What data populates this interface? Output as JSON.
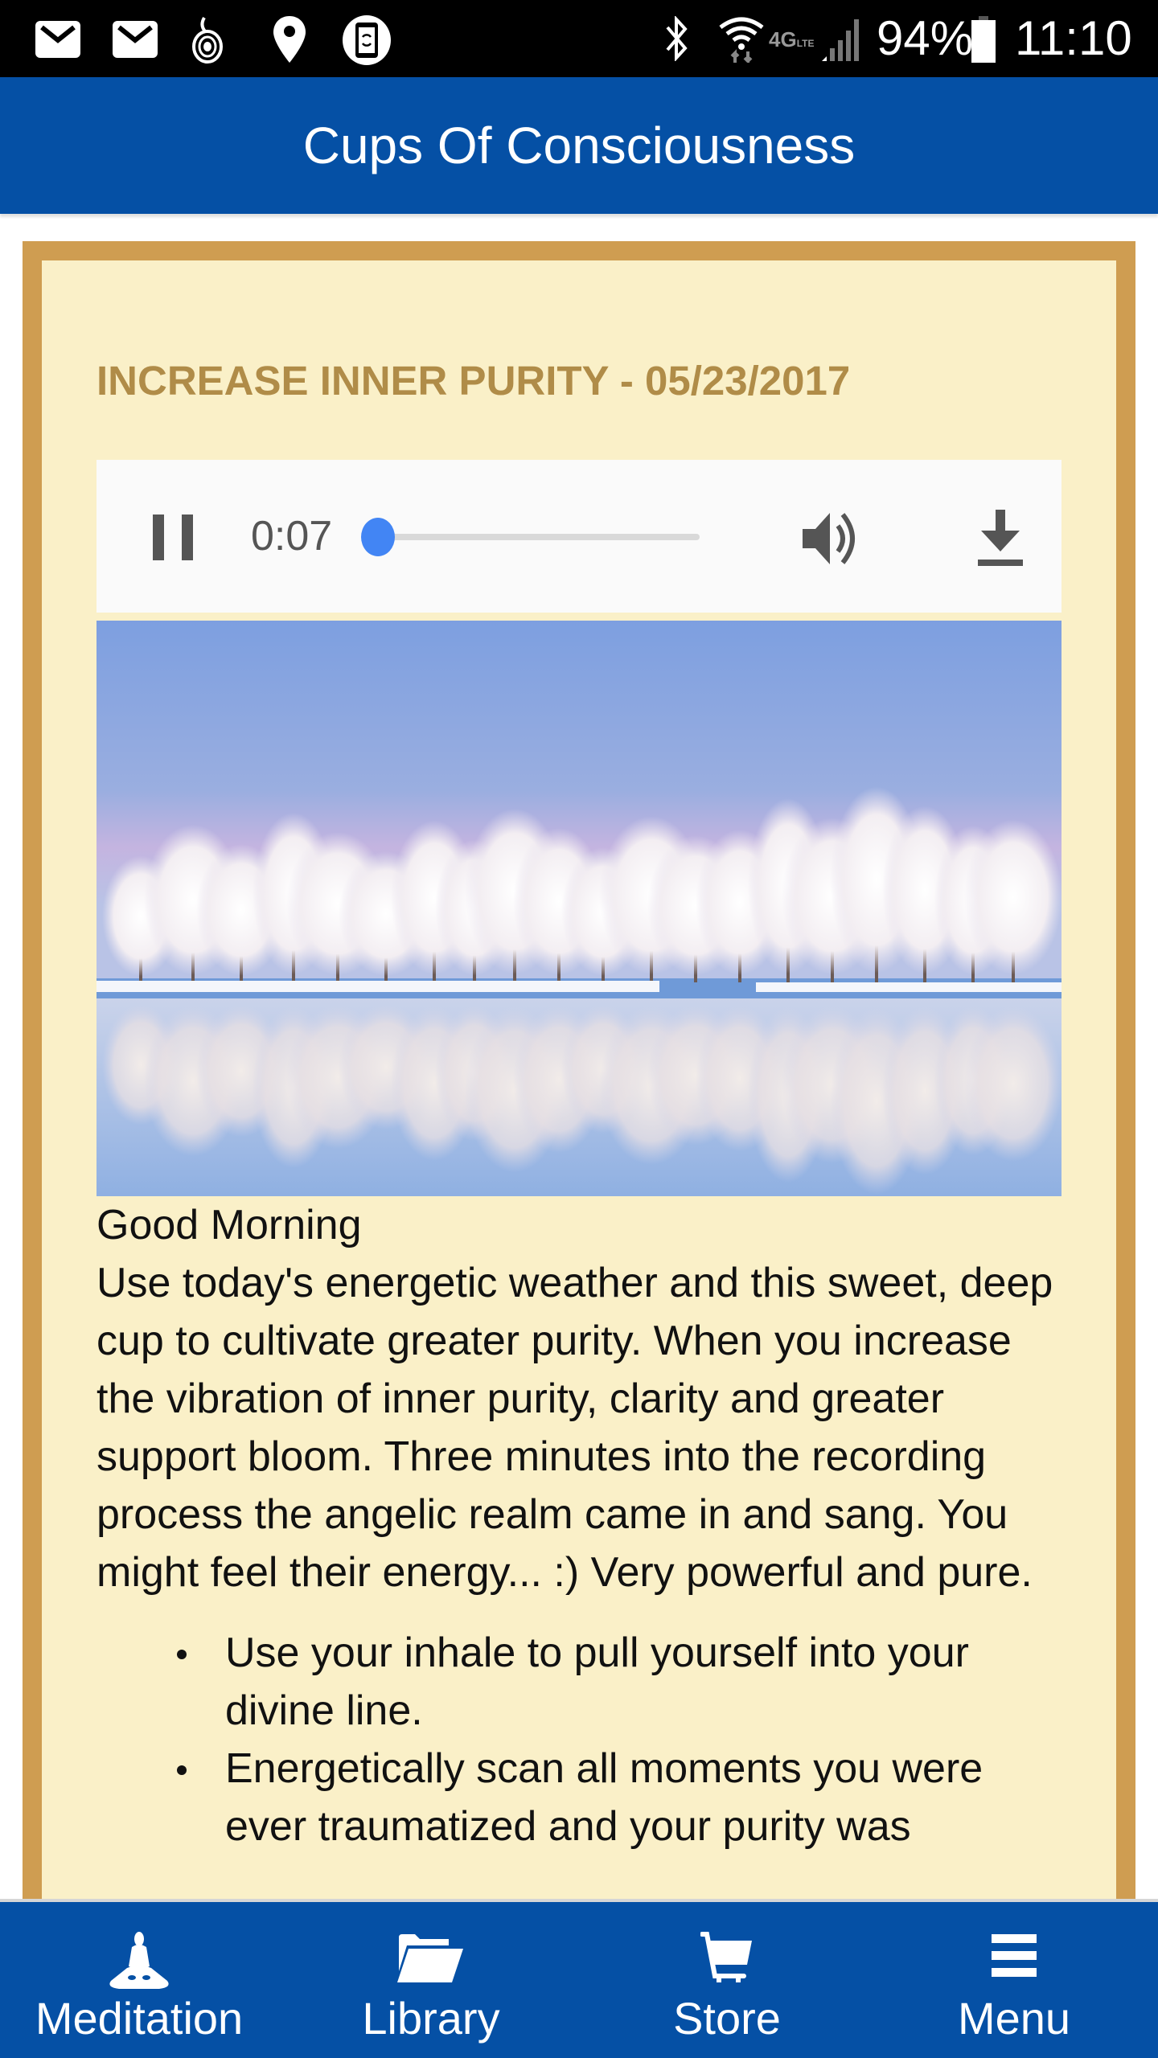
{
  "status_bar": {
    "left_icons": [
      "mail-icon",
      "mail-icon",
      "app-notification-icon",
      "location-pin-icon",
      "screen-rotation-icon"
    ],
    "right_icons": [
      "bluetooth-icon",
      "wifi-icon",
      "4g-lte-icon",
      "signal-icon",
      "battery-icon"
    ],
    "battery_percent": "94%",
    "time": "11:10"
  },
  "app_bar": {
    "title": "Cups Of Consciousness"
  },
  "colors": {
    "app_bar": "#0550a5",
    "frame_border": "#cf9d51",
    "frame_bg": "#faf0c8",
    "title_text": "#b08c48",
    "seek_thumb": "#4285f4"
  },
  "episode": {
    "title": "INCREASE INNER PURITY - 05/23/2017",
    "image_description": "frosted white trees reflected in calm lake under blue and pink sky"
  },
  "player": {
    "state": "playing",
    "pause_icon": "pause-icon",
    "current_time": "0:07",
    "progress_fraction": 0.05,
    "volume_icon": "volume-icon",
    "download_icon": "download-icon"
  },
  "body": {
    "greeting": "Good Morning",
    "paragraph": "Use today's energetic weather and this sweet, deep cup to cultivate greater purity. When you increase the vibration of inner purity, clarity and greater support bloom. Three minutes into the recording process the angelic realm came in and sang. You might feel their energy... :) Very powerful and pure.",
    "bullets": [
      "Use your inhale to pull yourself into your divine line.",
      "Energetically scan all moments you were ever traumatized and your purity was"
    ]
  },
  "bottom_nav": {
    "items": [
      {
        "label": "Meditation",
        "icon": "meditation-icon"
      },
      {
        "label": "Library",
        "icon": "folder-icon"
      },
      {
        "label": "Store",
        "icon": "cart-icon"
      },
      {
        "label": "Menu",
        "icon": "menu-icon"
      }
    ]
  }
}
